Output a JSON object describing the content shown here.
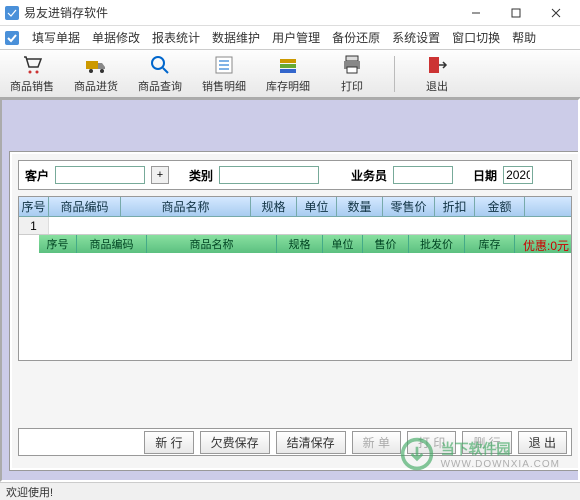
{
  "window": {
    "title": "易友进销存软件"
  },
  "menubar": [
    "填写单据",
    "单据修改",
    "报表统计",
    "数据维护",
    "用户管理",
    "备份还原",
    "系统设置",
    "窗口切换",
    "帮助"
  ],
  "toolbar": [
    {
      "label": "商品销售",
      "icon": "cart"
    },
    {
      "label": "商品进货",
      "icon": "truck"
    },
    {
      "label": "商品查询",
      "icon": "search"
    },
    {
      "label": "销售明细",
      "icon": "list"
    },
    {
      "label": "库存明细",
      "icon": "stack"
    },
    {
      "label": "打印",
      "icon": "printer"
    },
    {
      "label": "退出",
      "icon": "exit"
    }
  ],
  "filters": {
    "customer_label": "客户",
    "customer_value": "",
    "category_label": "类别",
    "category_value": "",
    "salesman_label": "业务员",
    "salesman_value": "",
    "date_label": "日期",
    "date_value": "2020"
  },
  "main_grid_headers": [
    "序号",
    "商品编码",
    "商品名称",
    "规格",
    "单位",
    "数量",
    "零售价",
    "折扣",
    "金额"
  ],
  "main_row_num": "1",
  "sub_grid_headers": [
    "序号",
    "商品编码",
    "商品名称",
    "规格",
    "单位",
    "售价",
    "批发价",
    "库存"
  ],
  "promo_text": "优惠:0元",
  "action_buttons": [
    {
      "label": "新 行",
      "enabled": true
    },
    {
      "label": "欠费保存",
      "enabled": true
    },
    {
      "label": "结清保存",
      "enabled": true
    },
    {
      "label": "新 单",
      "enabled": false
    },
    {
      "label": "打 印",
      "enabled": false
    },
    {
      "label": "删 行",
      "enabled": false
    },
    {
      "label": "退 出",
      "enabled": true
    }
  ],
  "status_text": "欢迎使用!",
  "watermark": {
    "line1": "当下软件园",
    "line2": "WWW.DOWNXIA.COM"
  },
  "main_col_widths": [
    30,
    72,
    130,
    46,
    40,
    46,
    52,
    40,
    50
  ],
  "sub_col_widths": [
    38,
    70,
    130,
    46,
    40,
    46,
    56,
    50
  ]
}
